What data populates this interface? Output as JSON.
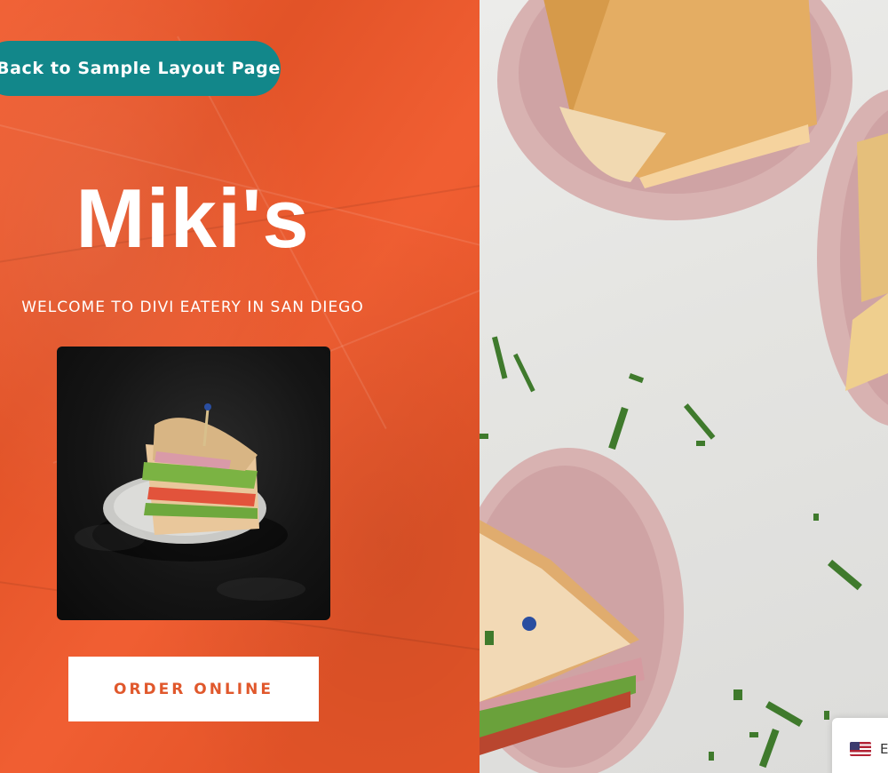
{
  "nav": {
    "back_label": "Back to Sample Layout Page"
  },
  "hero": {
    "brand": "Miki's",
    "tagline": "WELCOME TO DIVI EATERY IN SAN DIEGO",
    "order_label": "ORDER ONLINE"
  },
  "language": {
    "code": "E",
    "flag_icon": "us-flag-icon"
  },
  "colors": {
    "accent": "#f0582a",
    "teal": "#12878a",
    "button_text": "#e0582c"
  }
}
